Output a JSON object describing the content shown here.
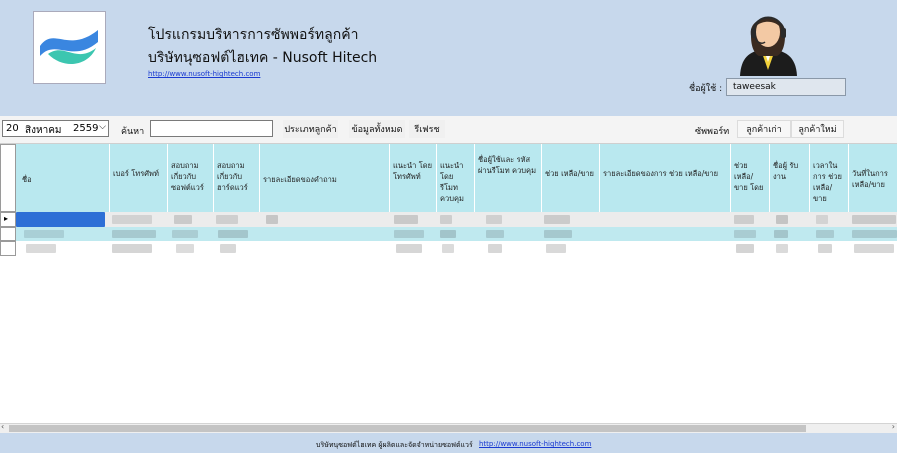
{
  "header": {
    "app_title": "โปรแกรมบริหารการซัพพอร์ทลูกค้า",
    "company_name": "บริษัทนุซอฟต์ไฮเทค - Nusoft Hitech",
    "website_link": "http://www.nusoft-hightech.com",
    "user_label": "ชื่อผู้ใช้ :",
    "user_value": "taweesak"
  },
  "toolbar": {
    "date_day": "20",
    "date_month": "สิงหาคม",
    "date_year": "2559",
    "search_label": "ค้นหา",
    "search_value": "",
    "customer_type_button": "ประเภทลูกค้า",
    "all_data_button": "ข้อมูลทั้งหมด",
    "refresh_button": "รีเฟรช",
    "support_label": "ซัพพอร์ท",
    "old_customer_button": "ลูกค้าเก่า",
    "new_customer_button": "ลูกค้าใหม่"
  },
  "table": {
    "columns": [
      {
        "label": "ชื่อ"
      },
      {
        "label": "เบอร์ โทรศัพท์"
      },
      {
        "label": "สอบถาม เกี่ยวกับ ซอฟต์แวร์"
      },
      {
        "label": "สอบถาม เกี่ยวกับ ฮาร์ดแวร์"
      },
      {
        "label": "รายละเอียดของคำถาม"
      },
      {
        "label": "แนะนำ โดย โทรศัพท์"
      },
      {
        "label": "แนะนำ โดย รีโมท ควบคุม"
      },
      {
        "label": "ชื่อผู้ใช้และ รหัส ผ่านรีโมท ควบคุม"
      },
      {
        "label": "ช่วย เหลือ/ขาย"
      },
      {
        "label": "รายละเอียดของการ ช่วย เหลือ/ขาย"
      },
      {
        "label": "ช่วย เหลือ/ขาย โดย"
      },
      {
        "label": "ชื่อผู้ รับ งาน"
      },
      {
        "label": "เวลาใน การ ช่วย เหลือ/ขาย"
      },
      {
        "label": "วันที่ในการ เหลือ/ขาย"
      }
    ]
  },
  "footer": {
    "text": "บริษัทนุซอฟต์ไฮเทค ผู้ผลิตและจัดจำหน่ายซอฟต์แวร์",
    "link": "http://www.nusoft-hightech.com"
  },
  "colors": {
    "header_bg": "#c7d8ec",
    "column_header_bg": "#b9e8ef",
    "selected_cell": "#2d6fd6",
    "link": "#1a3ad1"
  }
}
